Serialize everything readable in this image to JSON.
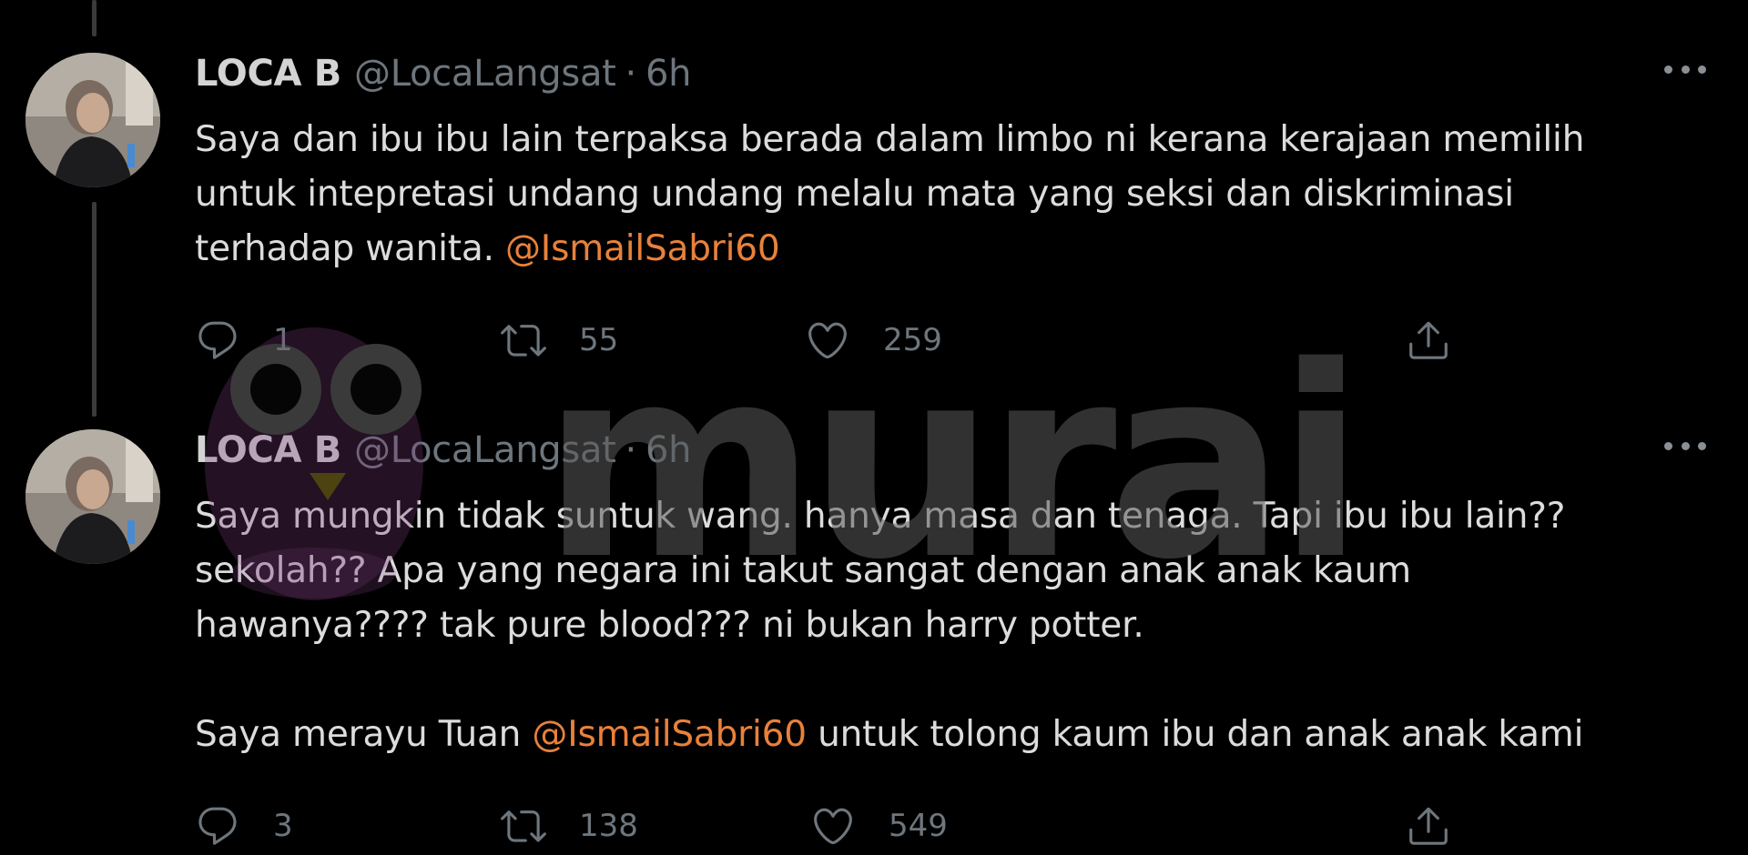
{
  "tweets": [
    {
      "name": "LOCA B",
      "handle": "@LocaLangsat",
      "separator": "·",
      "time": "6h",
      "paragraphs": [
        {
          "text_before": "Saya dan ibu ibu lain terpaksa berada dalam limbo ni kerana kerajaan memilih untuk intepretasi undang undang melalu mata yang seksi dan diskriminasi terhadap wanita. ",
          "mention": "@IsmailSabri60",
          "text_after": ""
        }
      ],
      "stats": {
        "replies": "1",
        "retweets": "55",
        "likes": "259"
      }
    },
    {
      "name": "LOCA B",
      "handle": "@LocaLangsat",
      "separator": "·",
      "time": "6h",
      "paragraphs": [
        {
          "text_before": "Saya mungkin tidak suntuk wang. hanya masa dan tenaga. Tapi ibu ibu lain?? sekolah?? Apa yang negara ini takut sangat dengan anak anak kaum hawanya???? tak pure blood??? ni bukan harry potter.",
          "mention": "",
          "text_after": ""
        },
        {
          "text_before": "Saya merayu Tuan ",
          "mention": "@IsmailSabri60",
          "text_after": " untuk tolong kaum ibu dan anak anak kami"
        }
      ],
      "stats": {
        "replies": "3",
        "retweets": "138",
        "likes": "549"
      }
    }
  ],
  "watermark": {
    "text": "murai"
  },
  "icons": {
    "reply": "reply-icon",
    "retweet": "retweet-icon",
    "like": "heart-icon",
    "share": "share-icon",
    "more": "more-icon"
  },
  "colors": {
    "background": "#000000",
    "mention": "#e8813b",
    "secondary": "#6e767d"
  }
}
